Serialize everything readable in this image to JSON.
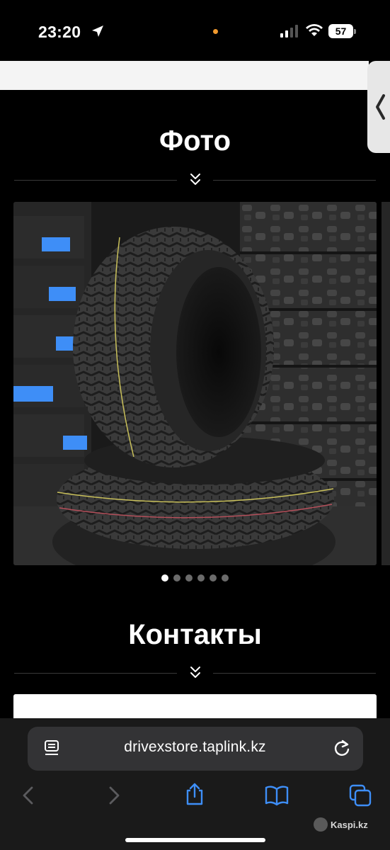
{
  "status_bar": {
    "time": "23:20",
    "battery": "57"
  },
  "sections": {
    "photos_title": "Фото",
    "contacts_title": "Контакты"
  },
  "gallery": {
    "slide_count": 6,
    "active_index": 0
  },
  "browser": {
    "url": "drivexstore.taplink.kz"
  },
  "watermark": "Kaspi.kz",
  "colors": {
    "accent_blue": "#3e8ef7",
    "background": "#000000",
    "orange_indicator": "#f29a2e"
  }
}
